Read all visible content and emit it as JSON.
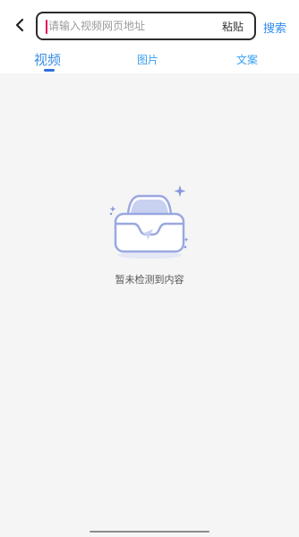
{
  "header": {
    "back_icon": "chevron-left-icon",
    "search": {
      "placeholder": "请输入视频网页地址",
      "value": ""
    },
    "paste_label": "粘贴",
    "search_label": "搜索"
  },
  "tabs": [
    {
      "label": "视频",
      "active": true
    },
    {
      "label": "图片",
      "active": false
    },
    {
      "label": "文案",
      "active": false
    }
  ],
  "empty_state": {
    "icon": "empty-inbox-icon",
    "message": "暂未检测到内容"
  },
  "colors": {
    "accent": "#2f8df0",
    "tab_active": "#3a8ee6",
    "illustration": "#a9b6e6"
  }
}
